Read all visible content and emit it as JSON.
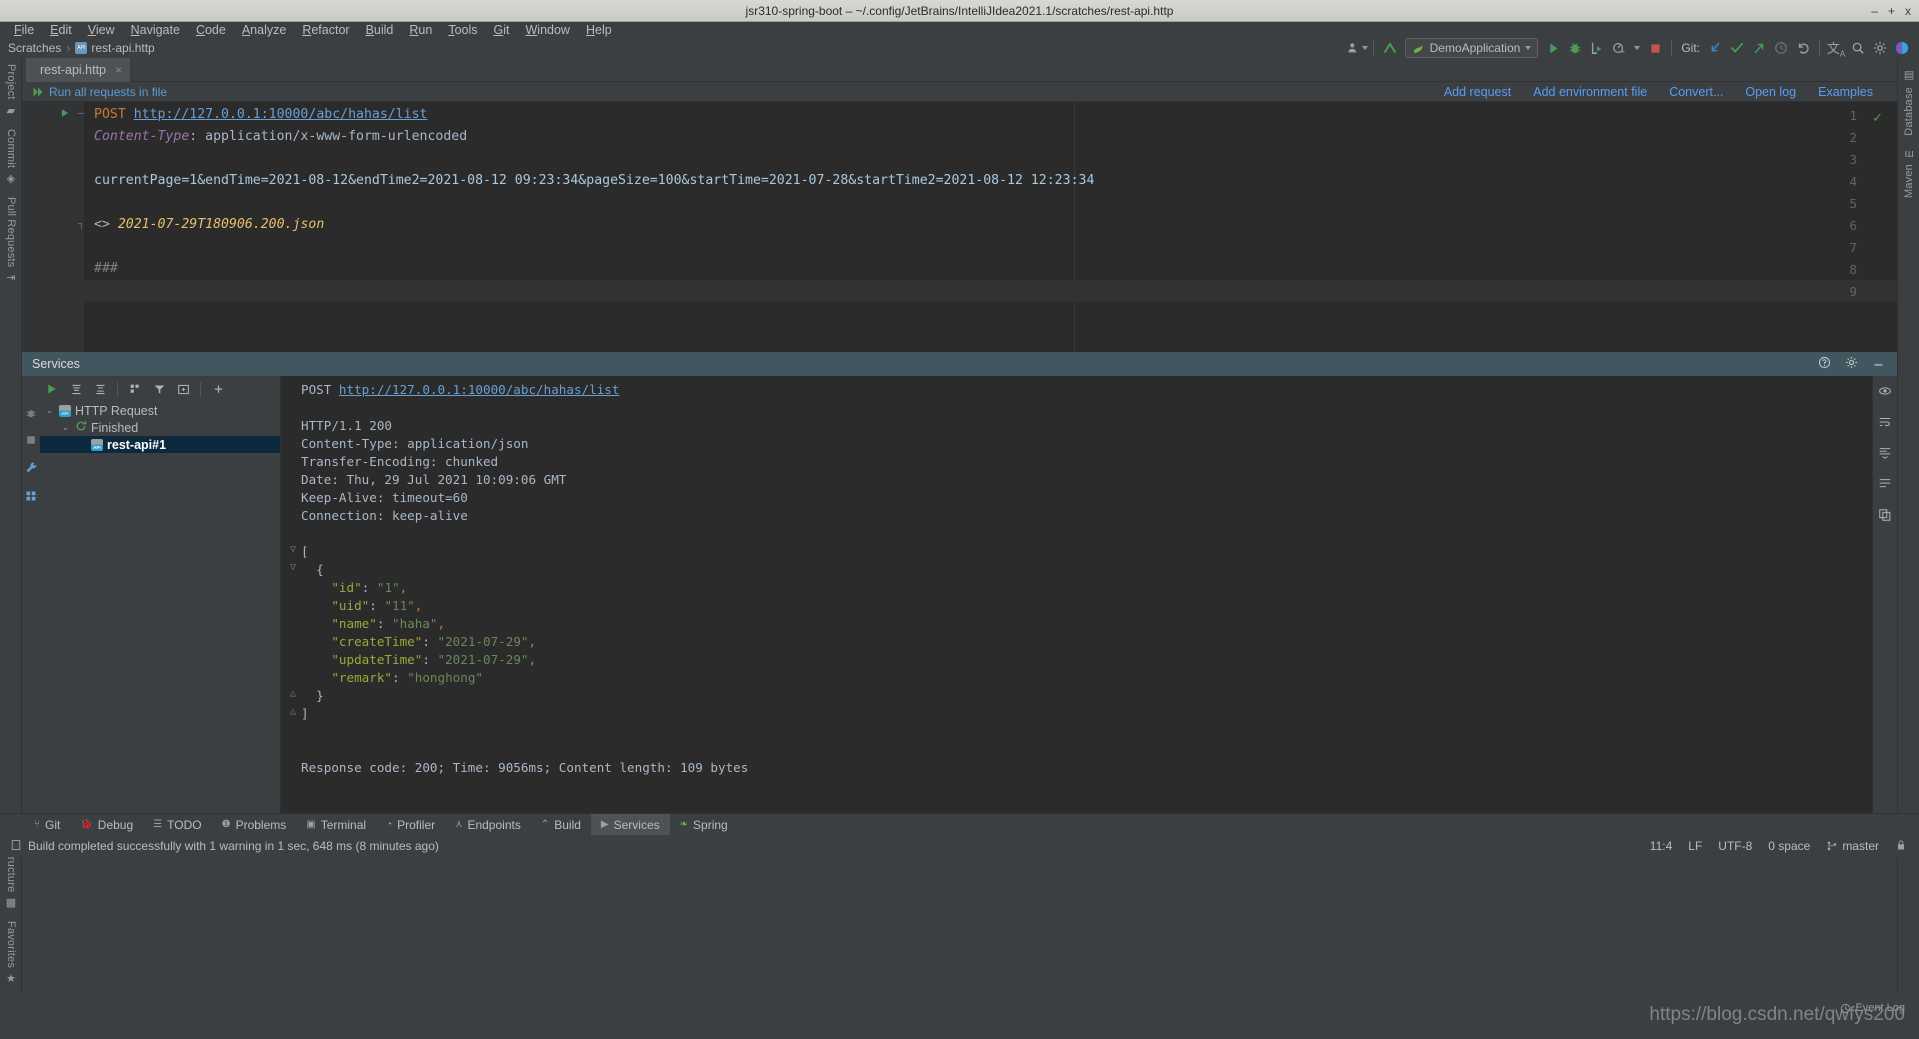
{
  "window": {
    "title": "jsr310-spring-boot – ~/.config/JetBrains/IntelliJIdea2021.1/scratches/rest-api.http",
    "minimize": "–",
    "maximize": "+",
    "close": "x"
  },
  "menubar": {
    "items": [
      "File",
      "Edit",
      "View",
      "Navigate",
      "Code",
      "Analyze",
      "Refactor",
      "Build",
      "Run",
      "Tools",
      "Git",
      "Window",
      "Help"
    ]
  },
  "breadcrumb": {
    "root": "Scratches",
    "separator": "›",
    "file": "rest-api.http"
  },
  "toolbar": {
    "run_config": "DemoApplication",
    "git_label": "Git:",
    "icons": [
      "user-avatar-icon",
      "update-project-icon",
      "run-icon",
      "debug-icon",
      "run-with-coverage-icon",
      "profile-icon",
      "stop-icon",
      "git-update-icon",
      "git-commit-icon",
      "git-push-icon",
      "git-history-icon",
      "git-rollback-icon",
      "translate-icon",
      "search-everywhere-icon",
      "settings-gear-icon",
      "ide-theme-icon"
    ]
  },
  "editor_tabs": [
    {
      "label": "rest-api.http",
      "icon": "api-file-icon",
      "close": "×",
      "active": true
    }
  ],
  "editor_header": {
    "run_all": "Run all requests in file",
    "links": [
      "Add request",
      "Add environment file",
      "Convert...",
      "Open log",
      "Examples"
    ]
  },
  "editor": {
    "lines": [
      {
        "n": 1,
        "gutter_run": true,
        "fold": "─",
        "segments": [
          {
            "t": "POST ",
            "c": "k-method"
          },
          {
            "t": "http://127.0.0.1:10000/abc/hahas/list",
            "c": "k-url"
          }
        ]
      },
      {
        "n": 2,
        "segments": [
          {
            "t": "Content-Type",
            "c": "k-hdr"
          },
          {
            "t": ": application/x-www-form-urlencoded",
            "c": "k-plain"
          }
        ]
      },
      {
        "n": 3,
        "segments": []
      },
      {
        "n": 4,
        "segments": [
          {
            "t": "currentPage=1&endTime=2021-08-12&endTime2=2021-08-12 09:23:34&pageSize=100&startTime=2021-07-28&startTime2=2021-08-12 12:23:34",
            "c": "k-body"
          }
        ]
      },
      {
        "n": 5,
        "segments": []
      },
      {
        "n": 6,
        "fold": "┐",
        "segments": [
          {
            "t": "<> ",
            "c": "k-plain"
          },
          {
            "t": "2021-07-29T180906.200.json",
            "c": "k-file"
          }
        ]
      },
      {
        "n": 7,
        "segments": []
      },
      {
        "n": 8,
        "segments": [
          {
            "t": "###",
            "c": "k-cmt"
          }
        ]
      },
      {
        "n": 9,
        "segments": [],
        "current": true
      }
    ]
  },
  "services": {
    "title": "Services",
    "toolbar_icons": [
      "run-icon",
      "expand-all-icon",
      "collapse-all-icon",
      "group-icon",
      "filter-icon",
      "new-tab-icon",
      "add-icon"
    ],
    "header_right_icons": [
      "settings-gear-icon",
      "help-icon",
      "hide-icon"
    ],
    "left_rail_icons": [
      "run-icon",
      "debug-icon",
      "stop-icon",
      "wrench-icon",
      "grid-icon"
    ],
    "right_rail_icons": [
      "eye-icon",
      "wrap-text-icon",
      "scroll-end-icon",
      "soft-wrap-icon",
      "copy-icon"
    ],
    "tree": [
      {
        "depth": 0,
        "chevron": "⌄",
        "icon": "api-file-icon",
        "label": "HTTP Request",
        "selected": false
      },
      {
        "depth": 1,
        "chevron": "⌄",
        "icon": "refresh-icon",
        "label": "Finished",
        "selected": false
      },
      {
        "depth": 2,
        "chevron": "",
        "icon": "api-file-icon",
        "label": "rest-api#1",
        "selected": true
      }
    ],
    "console": {
      "request_method": "POST",
      "request_url": "http://127.0.0.1:10000/abc/hahas/list",
      "headers": [
        "HTTP/1.1 200",
        "Content-Type: application/json",
        "Transfer-Encoding: chunked",
        "Date: Thu, 29 Jul 2021 10:09:06 GMT",
        "Keep-Alive: timeout=60",
        "Connection: keep-alive"
      ],
      "json_lines": [
        {
          "fold": "▽",
          "segments": [
            {
              "t": "[",
              "c": "j-white"
            }
          ]
        },
        {
          "fold": "▽",
          "segments": [
            {
              "t": "  {",
              "c": "j-white"
            }
          ]
        },
        {
          "fold": "",
          "segments": [
            {
              "t": "    ",
              "c": "j-white"
            },
            {
              "t": "\"id\"",
              "c": "j-key"
            },
            {
              "t": ": ",
              "c": "j-white"
            },
            {
              "t": "\"1\"",
              "c": "j-str"
            },
            {
              "t": ",",
              "c": "j-punc"
            }
          ]
        },
        {
          "fold": "",
          "segments": [
            {
              "t": "    ",
              "c": "j-white"
            },
            {
              "t": "\"uid\"",
              "c": "j-key"
            },
            {
              "t": ": ",
              "c": "j-white"
            },
            {
              "t": "\"11\"",
              "c": "j-str"
            },
            {
              "t": ",",
              "c": "j-punc"
            }
          ]
        },
        {
          "fold": "",
          "segments": [
            {
              "t": "    ",
              "c": "j-white"
            },
            {
              "t": "\"name\"",
              "c": "j-key"
            },
            {
              "t": ": ",
              "c": "j-white"
            },
            {
              "t": "\"haha\"",
              "c": "j-str"
            },
            {
              "t": ",",
              "c": "j-punc"
            }
          ]
        },
        {
          "fold": "",
          "segments": [
            {
              "t": "    ",
              "c": "j-white"
            },
            {
              "t": "\"createTime\"",
              "c": "j-key"
            },
            {
              "t": ": ",
              "c": "j-white"
            },
            {
              "t": "\"2021-07-29\"",
              "c": "j-str"
            },
            {
              "t": ",",
              "c": "j-punc"
            }
          ]
        },
        {
          "fold": "",
          "segments": [
            {
              "t": "    ",
              "c": "j-white"
            },
            {
              "t": "\"updateTime\"",
              "c": "j-key"
            },
            {
              "t": ": ",
              "c": "j-white"
            },
            {
              "t": "\"2021-07-29\"",
              "c": "j-str"
            },
            {
              "t": ",",
              "c": "j-punc"
            }
          ]
        },
        {
          "fold": "",
          "segments": [
            {
              "t": "    ",
              "c": "j-white"
            },
            {
              "t": "\"remark\"",
              "c": "j-key"
            },
            {
              "t": ": ",
              "c": "j-white"
            },
            {
              "t": "\"honghong\"",
              "c": "j-str"
            }
          ]
        },
        {
          "fold": "△",
          "segments": [
            {
              "t": "  }",
              "c": "j-white"
            }
          ]
        },
        {
          "fold": "△",
          "segments": [
            {
              "t": "]",
              "c": "j-white"
            }
          ]
        }
      ],
      "summary": "Response code: 200; Time: 9056ms; Content length: 109 bytes"
    }
  },
  "tool_strips": {
    "left_top": [
      {
        "label": "Project",
        "icon": "folder-icon"
      },
      {
        "label": "Commit",
        "icon": "commit-icon"
      },
      {
        "label": "Pull Requests",
        "icon": "pull-request-icon"
      }
    ],
    "left_bottom": [
      {
        "label": "Structure",
        "icon": "structure-icon"
      },
      {
        "label": "Favorites",
        "icon": "star-icon"
      }
    ],
    "right_top": [
      {
        "label": "Database",
        "icon": "database-icon"
      },
      {
        "label": "Maven",
        "icon": "maven-icon"
      }
    ]
  },
  "bottom_bar": {
    "items": [
      {
        "label": "Git",
        "icon": "git-icon",
        "active": false
      },
      {
        "label": "Debug",
        "icon": "debug-icon",
        "active": false
      },
      {
        "label": "TODO",
        "icon": "todo-icon",
        "active": false
      },
      {
        "label": "Problems",
        "icon": "problems-icon",
        "active": false
      },
      {
        "label": "Terminal",
        "icon": "terminal-icon",
        "active": false
      },
      {
        "label": "Profiler",
        "icon": "profiler-icon",
        "active": false
      },
      {
        "label": "Endpoints",
        "icon": "endpoints-icon",
        "active": false
      },
      {
        "label": "Build",
        "icon": "build-icon",
        "active": false
      },
      {
        "label": "Services",
        "icon": "services-icon",
        "active": true
      },
      {
        "label": "Spring",
        "icon": "spring-icon",
        "active": false
      }
    ]
  },
  "status_bar": {
    "message": "Build completed successfully with 1 warning in 1 sec, 648 ms (8 minutes ago)",
    "caret": "11:4",
    "line_separator": "LF",
    "encoding": "UTF-8",
    "indent": "0 space",
    "branch": "master",
    "branch_icon": "git-branch-icon",
    "lock_icon": "lock-icon",
    "event_log": "Event Log"
  },
  "watermark": "https://blog.csdn.net/qwfys200",
  "colors": {
    "accent_blue": "#589df6",
    "editor_bg": "#2b2b2b",
    "panel_bg": "#3c3f41",
    "selection": "#0d293e",
    "services_header": "#41565e",
    "green": "#5a9e4b",
    "orange": "#cc7832",
    "string_green": "#6a8759",
    "key_olive": "#9aa83a"
  }
}
